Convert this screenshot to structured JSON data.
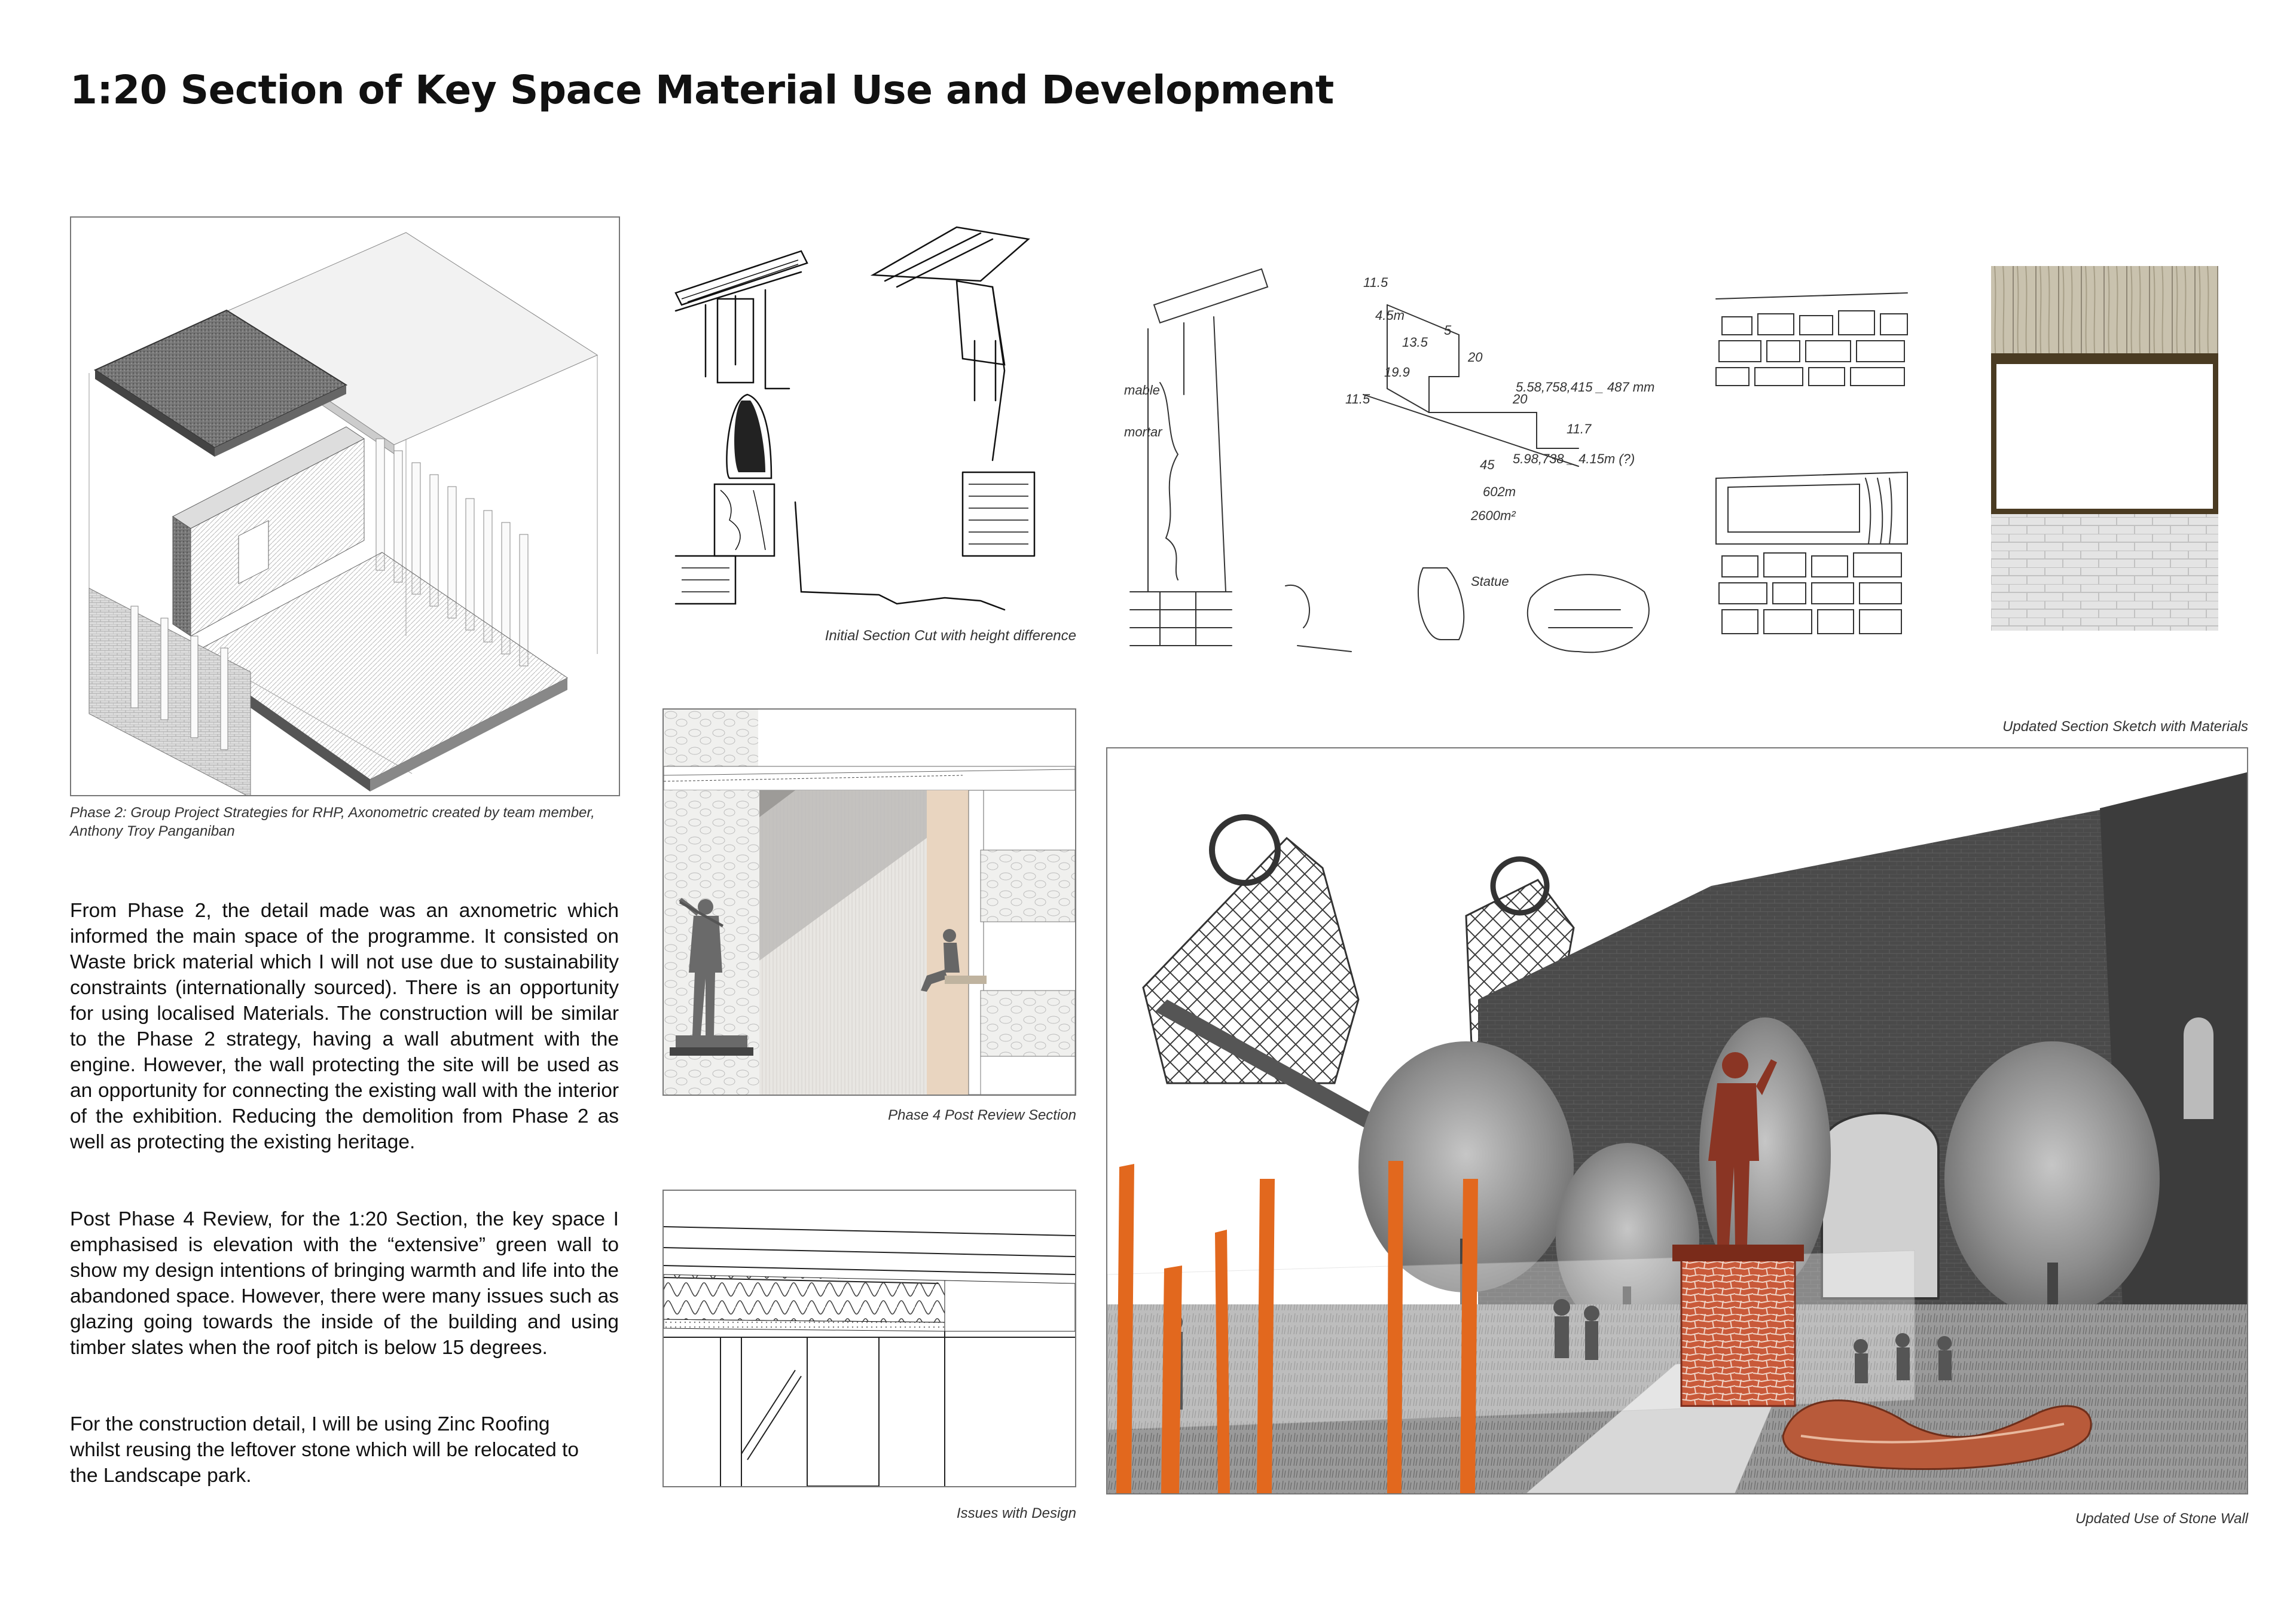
{
  "page": {
    "title": "1:20 Section of Key Space Material Use and Development"
  },
  "figures": {
    "axonometric": {
      "caption": "Phase 2: Group Project Strategies for RHP, Axonometric created by team member, Anthony Troy Panganiban"
    },
    "initial_section": {
      "caption": "Initial Section Cut with height difference"
    },
    "sketch_notes": {
      "labels": [
        "11.5",
        "4.5m",
        "13.5",
        "5",
        "20",
        "19.9",
        "11.5",
        "20",
        "5.58,758,415 _ 487 mm",
        "11.7",
        "45",
        "5.98,738 _ 4.15m (?)",
        "602m",
        "2600m²",
        "Statue",
        "mable",
        "mortar"
      ]
    },
    "updated_sketch": {
      "caption": "Updated Section Sketch with Materials"
    },
    "phase4_section": {
      "caption": "Phase 4 Post Review Section"
    },
    "issues": {
      "caption": "Issues with Design"
    },
    "stone_wall": {
      "caption": "Updated Use of Stone Wall"
    }
  },
  "body": {
    "paragraphs": [
      "From Phase 2, the detail made was an axnometric which informed the main space of the programme. It consisted on Waste brick material which I will not use due to sustainability constraints (internationally sourced). There is an opportunity for using localised Materials. The construction will be similar to the Phase 2 strategy, having a wall abutment with the engine. However, the wall protecting the site will be used as an opportunity for connecting the existing wall with the interior of the exhibition. Reducing the demolition from Phase 2 as well as protecting the existing heritage.",
      "Post Phase 4 Review, for the 1:20 Section, the key space I emphasised is elevation with the “extensive” green wall to show my design intentions of bringing warmth and life into the abandoned space. However, there were many issues such as glazing going towards the inside of the building and using timber slates when the roof pitch is below 15 degrees.",
      "For the construction detail, I will be using Zinc Roofing whilst reusing the leftover stone which will be relocated to the Landscape park."
    ]
  },
  "colors": {
    "text": "#111111",
    "frame_border": "#777777",
    "accent_orange": "#e2681e",
    "statue_red": "#8a3524",
    "timber_frame": "#4a3b22"
  }
}
